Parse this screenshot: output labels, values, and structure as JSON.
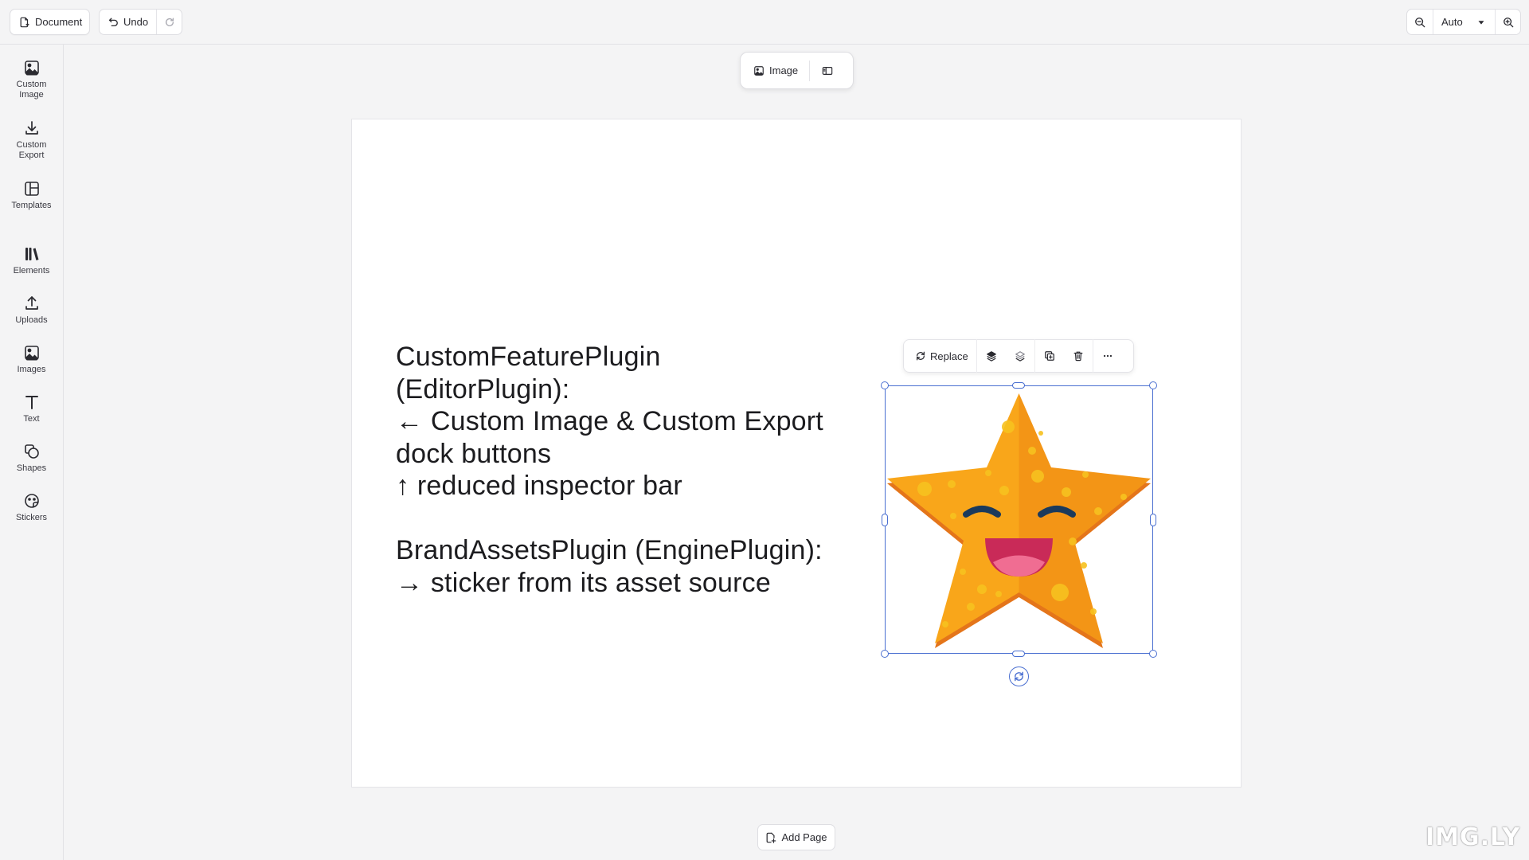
{
  "topbar": {
    "document_label": "Document",
    "undo_label": "Undo",
    "zoom_value": "Auto"
  },
  "dock": {
    "items": [
      {
        "label": "Custom Image",
        "icon": "image-icon"
      },
      {
        "label": "Custom Export",
        "icon": "download-icon"
      },
      {
        "label": "Templates",
        "icon": "template-icon"
      },
      {
        "label": "Elements",
        "icon": "library-icon"
      },
      {
        "label": "Uploads",
        "icon": "upload-icon"
      },
      {
        "label": "Images",
        "icon": "image-icon"
      },
      {
        "label": "Text",
        "icon": "text-icon"
      },
      {
        "label": "Shapes",
        "icon": "shapes-icon"
      },
      {
        "label": "Stickers",
        "icon": "sticker-icon"
      }
    ]
  },
  "inspector": {
    "image_label": "Image"
  },
  "canvas": {
    "text_lines": [
      "CustomFeaturePlugin",
      "(EditorPlugin):",
      "← Custom Image & Custom Export",
      "dock buttons",
      "↑ reduced inspector bar",
      "",
      "BrandAssetsPlugin (EnginePlugin):",
      "→ sticker from its asset source"
    ]
  },
  "context_bar": {
    "replace_label": "Replace"
  },
  "add_page_label": "Add Page",
  "watermark": "IMG.LY",
  "colors": {
    "selection": "#4a6fd1",
    "star_light": "#f9a61a",
    "star_dark": "#f08a14",
    "background": "#f4f4f5"
  }
}
